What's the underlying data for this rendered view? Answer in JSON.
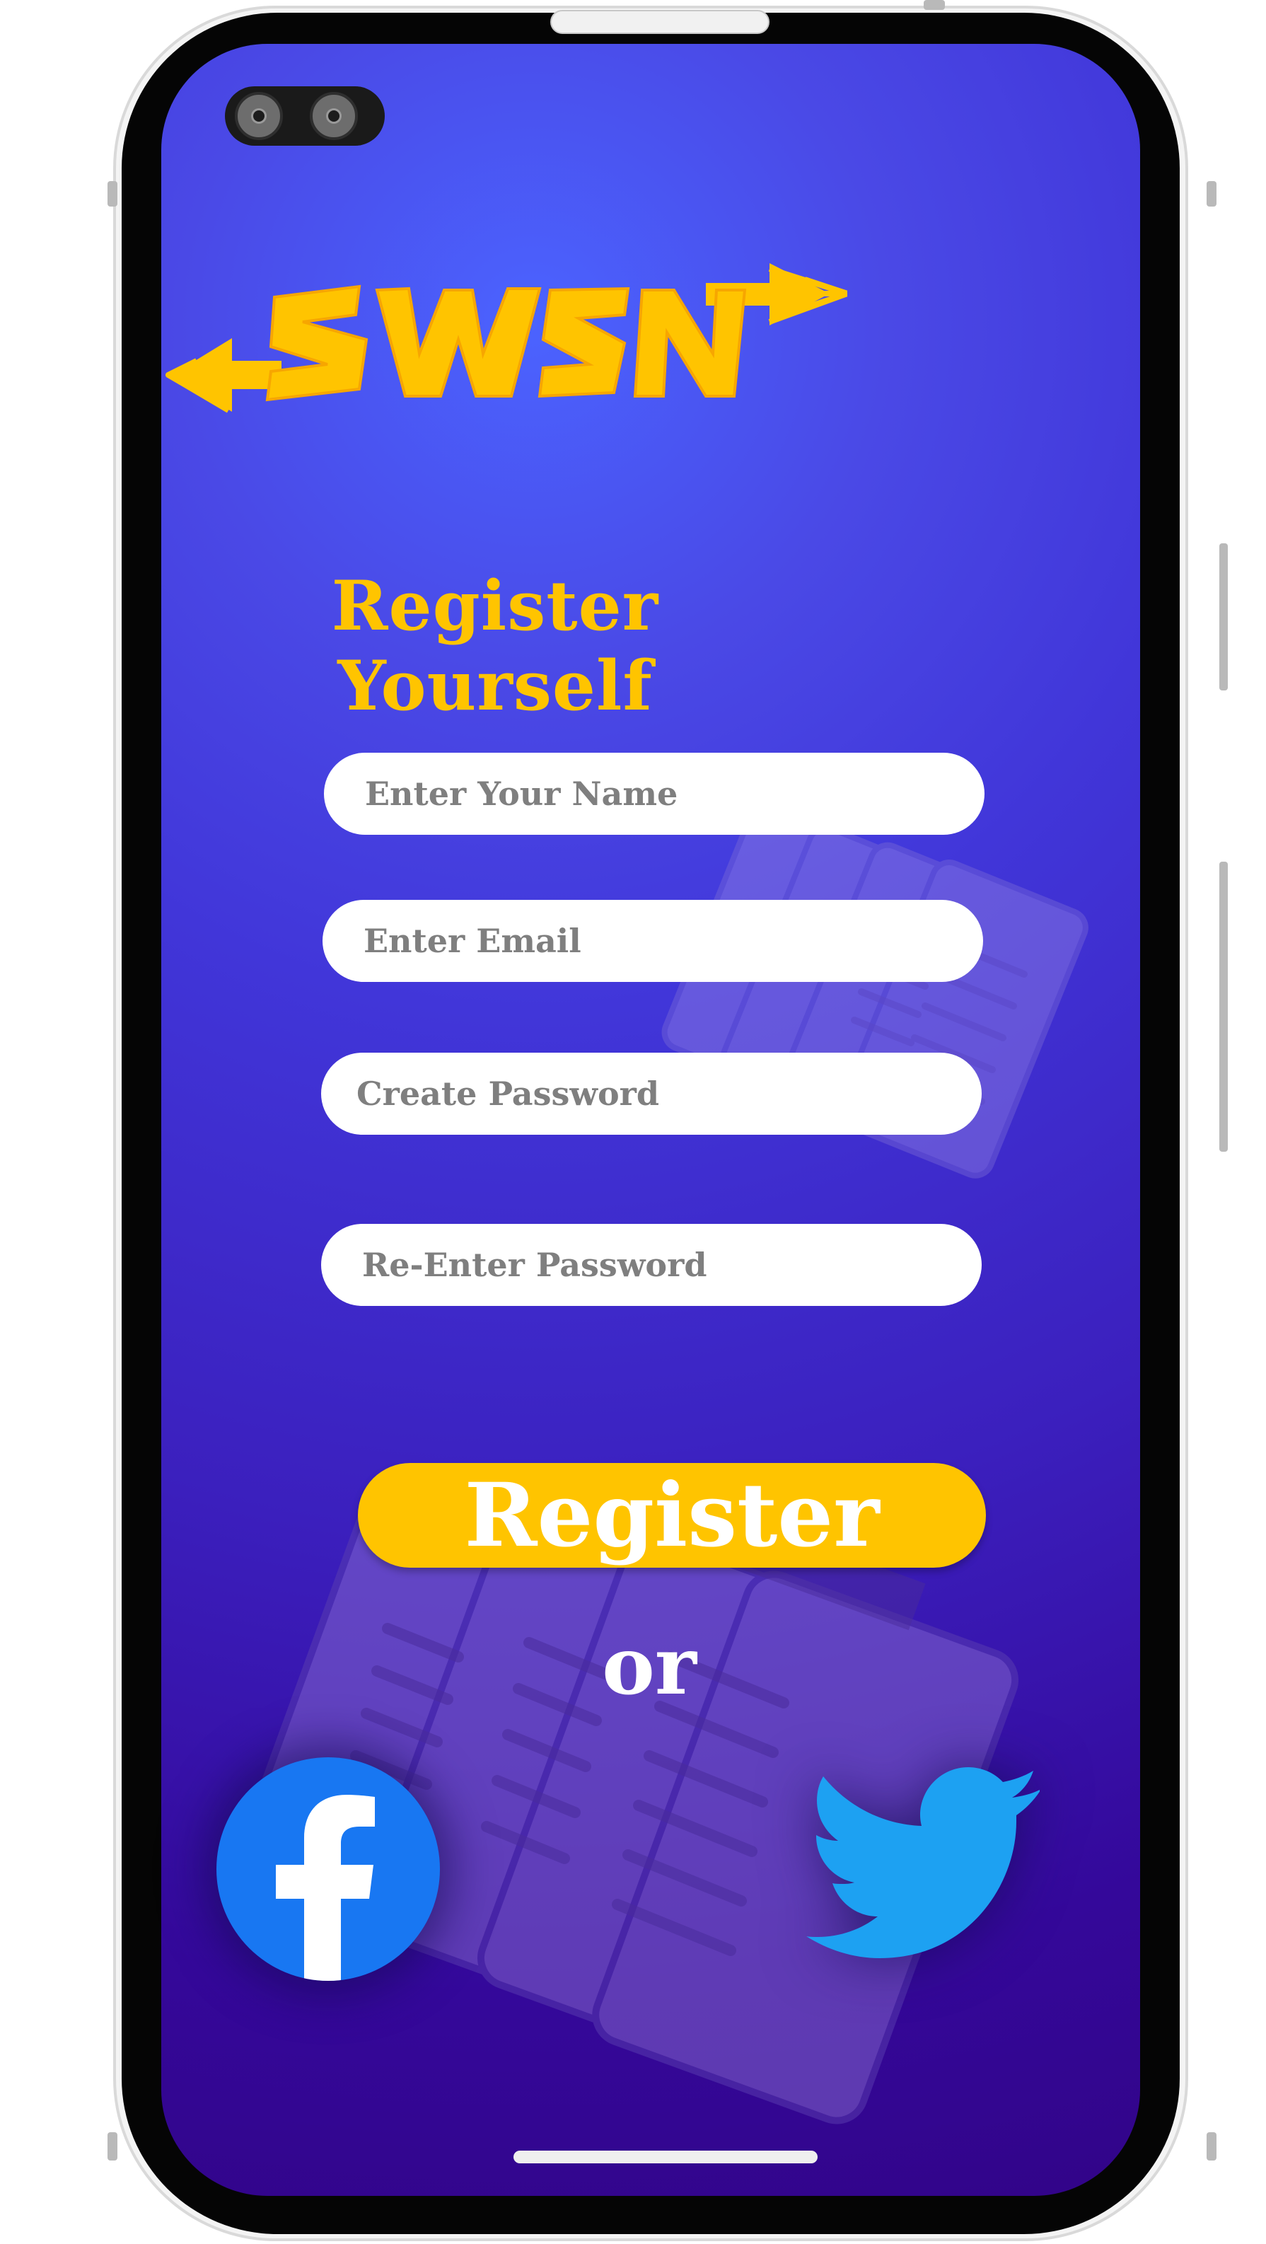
{
  "app": {
    "logo_text": "SWSN",
    "title": "Register Yourself"
  },
  "form": {
    "name_placeholder": "Enter Your Name",
    "email_placeholder": "Enter Email",
    "password_placeholder": "Create Password",
    "confirm_password_placeholder": "Re-Enter Password"
  },
  "actions": {
    "register_label": "Register",
    "or_label": "or"
  },
  "social": {
    "facebook_icon": "facebook-icon",
    "twitter_icon": "twitter-icon"
  },
  "colors": {
    "accent": "#ffc400",
    "background_top": "#4b63ff",
    "background_bottom": "#320488",
    "facebook": "#1877f2",
    "twitter": "#1da1f2"
  }
}
